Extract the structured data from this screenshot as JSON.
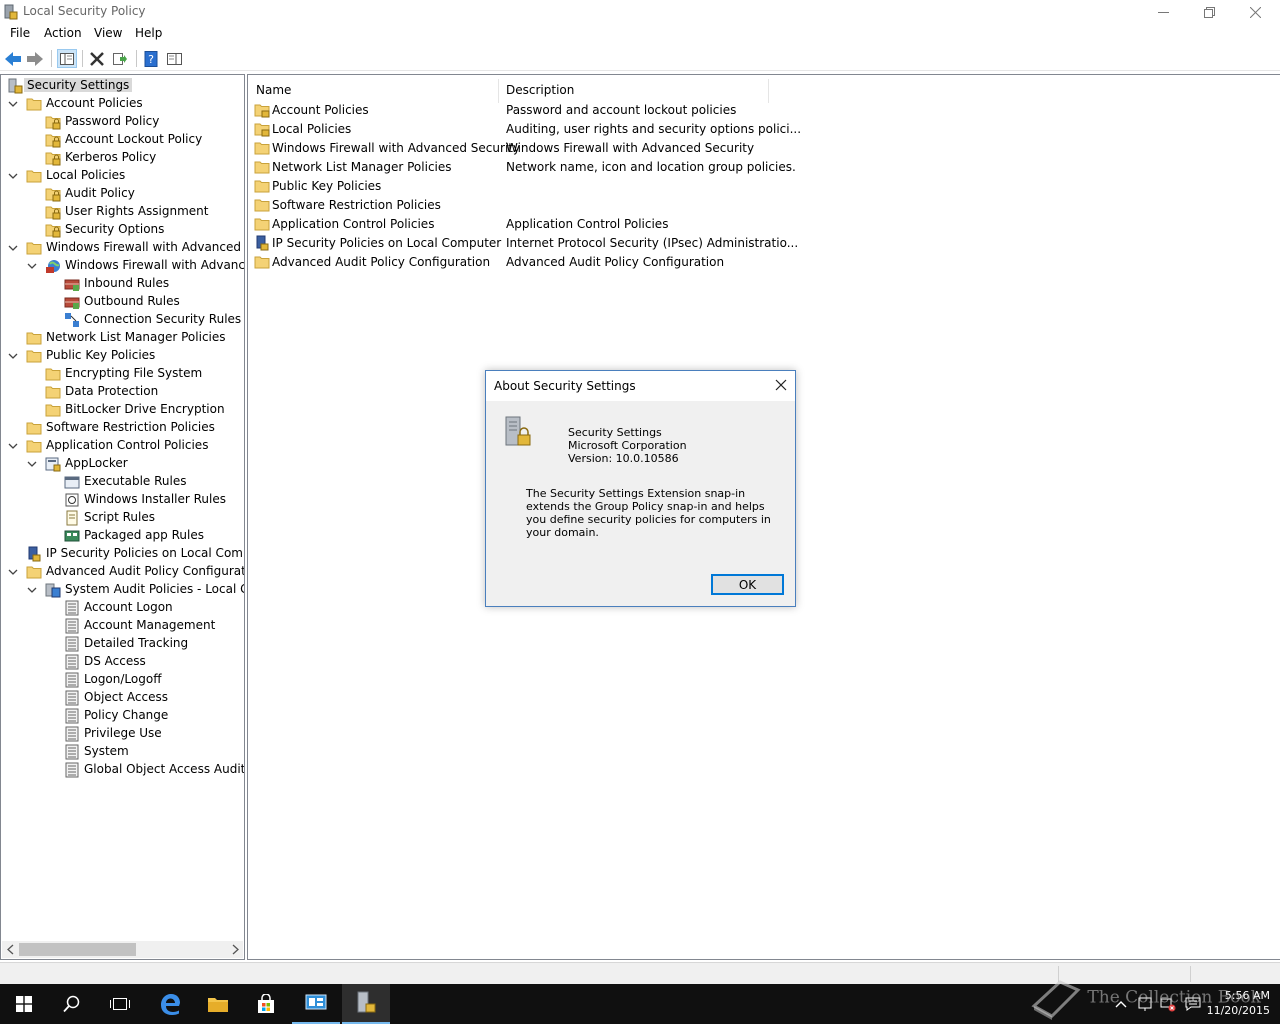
{
  "window": {
    "title": "Local Security Policy"
  },
  "menu": {
    "file": "File",
    "action": "Action",
    "view": "View",
    "help": "Help"
  },
  "tree": {
    "root": "Security Settings",
    "account_policies": "Account Policies",
    "password_policy": "Password Policy",
    "account_lockout_policy": "Account Lockout Policy",
    "kerberos_policy": "Kerberos Policy",
    "local_policies": "Local Policies",
    "audit_policy": "Audit Policy",
    "user_rights_assignment": "User Rights Assignment",
    "security_options": "Security Options",
    "wfas": "Windows Firewall with Advanced Secu",
    "wfas_child": "Windows Firewall with Advanced",
    "inbound_rules": "Inbound Rules",
    "outbound_rules": "Outbound Rules",
    "connection_security_rules": "Connection Security Rules",
    "network_list": "Network List Manager Policies",
    "public_key": "Public Key Policies",
    "efs": "Encrypting File System",
    "data_protection": "Data Protection",
    "bitlocker": "BitLocker Drive Encryption",
    "software_restriction": "Software Restriction Policies",
    "app_control": "Application Control Policies",
    "applocker": "AppLocker",
    "executable_rules": "Executable Rules",
    "windows_installer_rules": "Windows Installer Rules",
    "script_rules": "Script Rules",
    "packaged_app_rules": "Packaged app Rules",
    "ipsec": "IP Security Policies on Local Compute",
    "advanced_audit": "Advanced Audit Policy Configuration",
    "system_audit": "System Audit Policies - Local Grou",
    "account_logon": "Account Logon",
    "account_management": "Account Management",
    "detailed_tracking": "Detailed Tracking",
    "ds_access": "DS Access",
    "logon_logoff": "Logon/Logoff",
    "object_access": "Object Access",
    "policy_change": "Policy Change",
    "privilege_use": "Privilege Use",
    "system": "System",
    "global_object_access": "Global Object Access Auditing"
  },
  "list": {
    "col_name": "Name",
    "col_description": "Description",
    "rows": [
      {
        "name": "Account Policies",
        "description": "Password and account lockout policies"
      },
      {
        "name": "Local Policies",
        "description": "Auditing, user rights and security options polici..."
      },
      {
        "name": "Windows Firewall with Advanced Security",
        "description": "Windows Firewall with Advanced Security"
      },
      {
        "name": "Network List Manager Policies",
        "description": "Network name, icon and location group policies."
      },
      {
        "name": "Public Key Policies",
        "description": ""
      },
      {
        "name": "Software Restriction Policies",
        "description": ""
      },
      {
        "name": "Application Control Policies",
        "description": "Application Control Policies"
      },
      {
        "name": "IP Security Policies on Local Computer",
        "description": "Internet Protocol Security (IPsec) Administratio..."
      },
      {
        "name": "Advanced Audit Policy Configuration",
        "description": "Advanced Audit Policy Configuration"
      }
    ]
  },
  "dialog": {
    "title": "About Security Settings",
    "product": "Security Settings",
    "company": "Microsoft Corporation",
    "version": "Version: 10.0.10586",
    "description": "The Security Settings Extension snap-in extends the Group Policy snap-in and helps you define security policies for computers in your domain.",
    "ok_label": "OK"
  },
  "taskbar": {
    "time": "5:56 AM",
    "date": "11/20/2015"
  },
  "watermark": "The Collection Book",
  "colors": {
    "folder": "#e8c15a",
    "accent": "#0078d7",
    "taskbar": "#101010"
  }
}
